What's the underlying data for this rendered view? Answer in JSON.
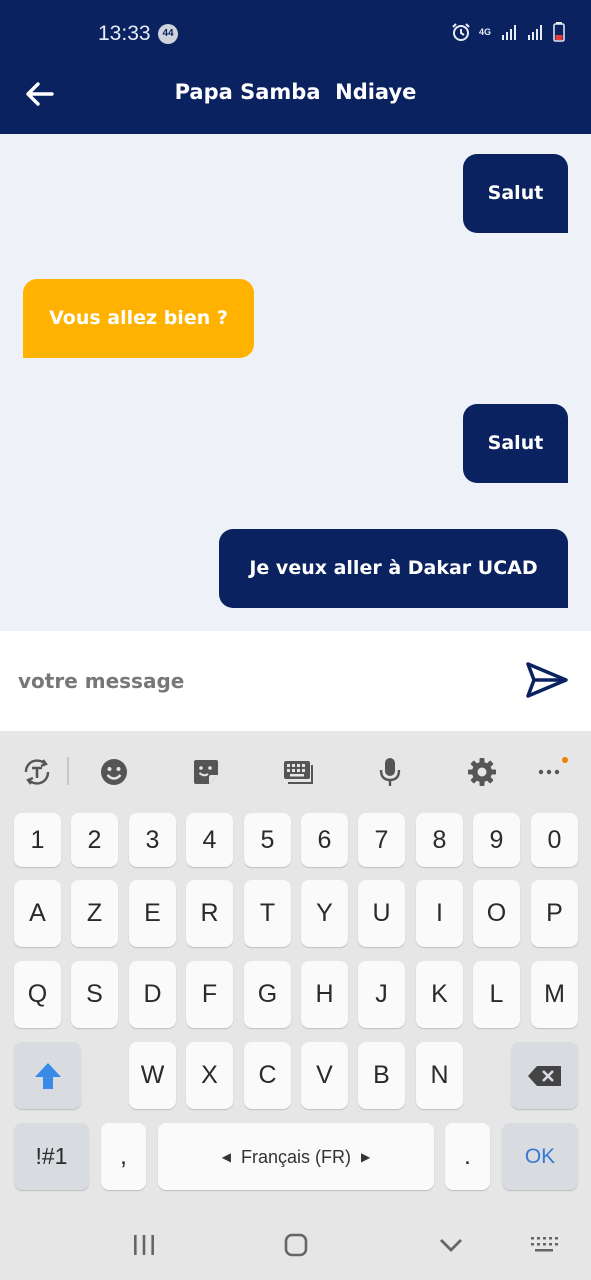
{
  "status_bar": {
    "time": "13:33",
    "notification_count": "44",
    "network_label": "4G"
  },
  "header": {
    "title": "Papa Samba  Ndiaye"
  },
  "messages": [
    {
      "text": "Salut",
      "direction": "outgoing"
    },
    {
      "text": "Vous allez bien ?",
      "direction": "incoming"
    },
    {
      "text": "Salut",
      "direction": "outgoing"
    },
    {
      "text": "Je veux aller à Dakar UCAD",
      "direction": "outgoing"
    }
  ],
  "composer": {
    "placeholder": "votre message",
    "value": ""
  },
  "keyboard": {
    "number_row": [
      "1",
      "2",
      "3",
      "4",
      "5",
      "6",
      "7",
      "8",
      "9",
      "0"
    ],
    "row1": [
      "A",
      "Z",
      "E",
      "R",
      "T",
      "Y",
      "U",
      "I",
      "O",
      "P"
    ],
    "row2": [
      "Q",
      "S",
      "D",
      "F",
      "G",
      "H",
      "J",
      "K",
      "L",
      "M"
    ],
    "row3": [
      "W",
      "X",
      "C",
      "V",
      "B",
      "N"
    ],
    "symbols_label": "!#1",
    "comma": ",",
    "space_label": "Français (FR)",
    "period": ".",
    "ok_label": "OK"
  },
  "colors": {
    "primary": "#0a2260",
    "incoming_bubble": "#ffb300",
    "chat_background": "#eef2f8",
    "keyboard_background": "#e6e6e6",
    "ok_text": "#3a78d6"
  }
}
